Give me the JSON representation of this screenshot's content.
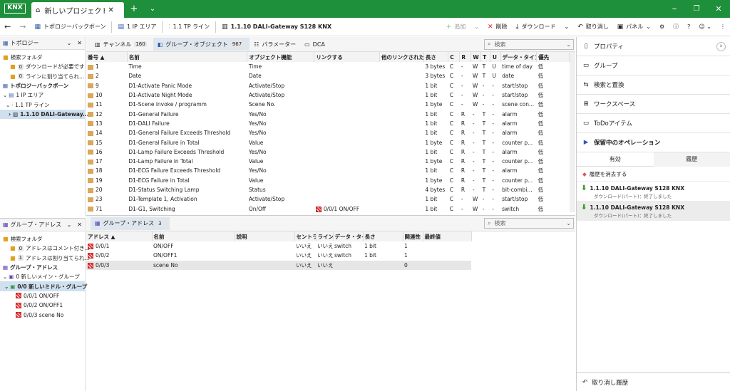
{
  "app": {
    "logo": "KNX",
    "tab_title": "新しいプロジェクト..."
  },
  "toolbar": {
    "breadcrumb": [
      "トポロジーバックボーン",
      "1 IP エリア",
      "1.1 TP ライン",
      "1.1.10 DALI-Gateway S128 KNX"
    ],
    "add": "追加",
    "delete": "削除",
    "download": "ダウンロード",
    "undo": "取り消し",
    "panel": "パネル"
  },
  "topology": {
    "title": "トポロジー",
    "items": [
      {
        "label": "検索フォルダ",
        "badge": ""
      },
      {
        "label": "ダウンロードが必要です",
        "badge": "0"
      },
      {
        "label": "ラインに割り当てられ...",
        "badge": "0"
      },
      {
        "label": "トポロジーバックボーン",
        "badge": ""
      },
      {
        "label": "1 IP エリア",
        "badge": ""
      },
      {
        "label": "1.1 TP ライン",
        "badge": ""
      },
      {
        "label": "1.1.10 DALI-Gateway...",
        "badge": ""
      }
    ]
  },
  "groups_panel": {
    "title": "グループ・アドレス",
    "items": [
      {
        "label": "検索フォルダ",
        "badge": ""
      },
      {
        "label": "アドレスはコメント付き...",
        "badge": "0"
      },
      {
        "label": "アドレスは割り当てられ...",
        "badge": "1"
      },
      {
        "label": "グループ・アドレス",
        "badge": ""
      },
      {
        "label": "0 新しいメイン・グループ",
        "badge": ""
      },
      {
        "label": "0/0 新しいミドル・グループ",
        "badge": ""
      },
      {
        "label": "0/0/1 ON/OFF",
        "badge": ""
      },
      {
        "label": "0/0/2 ON/OFF1",
        "badge": ""
      },
      {
        "label": "0/0/3 scene No",
        "badge": ""
      }
    ]
  },
  "main_tabs": [
    {
      "label": "チャンネル",
      "count": "160"
    },
    {
      "label": "グループ・オブジェクト",
      "count": "967"
    },
    {
      "label": "パラメーター",
      "count": ""
    },
    {
      "label": "DCA",
      "count": ""
    }
  ],
  "search_placeholder": "検索",
  "objects": {
    "headers": [
      "番号 ▲",
      "名前",
      "オブジェクト機能",
      "リンクする",
      "他のリンクされた...",
      "長さ",
      "C",
      "R",
      "W",
      "T",
      "U",
      "データ・タイプ",
      "優先"
    ],
    "rows": [
      [
        "1",
        "Time",
        "Time",
        "",
        "",
        "3 bytes",
        "C",
        "-",
        "W",
        "T",
        "U",
        "time of day",
        "低"
      ],
      [
        "2",
        "Date",
        "Date",
        "",
        "",
        "3 bytes",
        "C",
        "-",
        "W",
        "T",
        "U",
        "date",
        "低"
      ],
      [
        "9",
        "D1-Activate Panic Mode",
        "Activate/Stop",
        "",
        "",
        "1 bit",
        "C",
        "-",
        "W",
        "-",
        "-",
        "start/stop",
        "低"
      ],
      [
        "10",
        "D1-Activate Night Mode",
        "Activate/Stop",
        "",
        "",
        "1 bit",
        "C",
        "-",
        "W",
        "-",
        "-",
        "start/stop",
        "低"
      ],
      [
        "11",
        "D1-Scene invoke / programm",
        "Scene No.",
        "",
        "",
        "1 byte",
        "C",
        "-",
        "W",
        "-",
        "-",
        "scene con...",
        "低"
      ],
      [
        "12",
        "D1-General Failure",
        "Yes/No",
        "",
        "",
        "1 bit",
        "C",
        "R",
        "-",
        "T",
        "-",
        "alarm",
        "低"
      ],
      [
        "13",
        "D1-DALI Failure",
        "Yes/No",
        "",
        "",
        "1 bit",
        "C",
        "R",
        "-",
        "T",
        "-",
        "alarm",
        "低"
      ],
      [
        "14",
        "D1-General Failure Exceeds Threshold",
        "Yes/No",
        "",
        "",
        "1 bit",
        "C",
        "R",
        "-",
        "T",
        "-",
        "alarm",
        "低"
      ],
      [
        "15",
        "D1-General Failure in Total",
        "Value",
        "",
        "",
        "1 byte",
        "C",
        "R",
        "-",
        "T",
        "-",
        "counter p...",
        "低"
      ],
      [
        "16",
        "D1-Lamp Failure Exceeds Threshold",
        "Yes/No",
        "",
        "",
        "1 bit",
        "C",
        "R",
        "-",
        "T",
        "-",
        "alarm",
        "低"
      ],
      [
        "17",
        "D1-Lamp Failure in Total",
        "Value",
        "",
        "",
        "1 byte",
        "C",
        "R",
        "-",
        "T",
        "-",
        "counter p...",
        "低"
      ],
      [
        "18",
        "D1-ECG Failure Exceeds Threshold",
        "Yes/No",
        "",
        "",
        "1 bit",
        "C",
        "R",
        "-",
        "T",
        "-",
        "alarm",
        "低"
      ],
      [
        "19",
        "D1-ECG Failure in Total",
        "Value",
        "",
        "",
        "1 byte",
        "C",
        "R",
        "-",
        "T",
        "-",
        "counter p...",
        "低"
      ],
      [
        "20",
        "D1-Status Switching Lamp",
        "Status",
        "",
        "",
        "4 bytes",
        "C",
        "R",
        "-",
        "T",
        "-",
        "bit-combi...",
        "低"
      ],
      [
        "23",
        "D1-Template 1, Activation",
        "Activate/Stop",
        "",
        "",
        "1 bit",
        "C",
        "-",
        "W",
        "-",
        "-",
        "start/stop",
        "低"
      ],
      [
        "71",
        "D1-G1, Switching",
        "On/Off",
        "0/0/1 ON/OFF",
        "",
        "1 bit",
        "C",
        "-",
        "W",
        "-",
        "-",
        "switch",
        "低"
      ]
    ]
  },
  "ga_tab": {
    "label": "グループ・アドレス",
    "count": "3"
  },
  "addresses": {
    "headers": [
      "アドレス ▲",
      "名前",
      "説明",
      "セントラル",
      "ライン...",
      "データ・タイプ",
      "長さ",
      "関連性",
      "最終値"
    ],
    "rows": [
      [
        "0/0/1",
        "ON/OFF",
        "",
        "いいえ",
        "いいえ",
        "switch",
        "1 bit",
        "1",
        ""
      ],
      [
        "0/0/2",
        "ON/OFF1",
        "",
        "いいえ",
        "いいえ",
        "switch",
        "1 bit",
        "1",
        ""
      ],
      [
        "0/0/3",
        "scene No",
        "",
        "いいえ",
        "いいえ",
        "",
        "",
        "0",
        ""
      ]
    ]
  },
  "right": {
    "items": [
      "プロパティ",
      "グループ",
      "検索と置換",
      "ワークスペース",
      "ToDoアイテム"
    ],
    "pending": "保留中のオペレーション",
    "tabs": [
      "有効",
      "履歴"
    ],
    "clear": "履歴を消去する",
    "history": [
      {
        "title": "1.1.10 DALI-Gateway S128 KNX",
        "sub": "ダウンロード(パート)：終了しました"
      },
      {
        "title": "1.1.10 DALI-Gateway S128 KNX",
        "sub": "ダウンロード(パート)：終了しました"
      }
    ],
    "undo_history": "取り消し履歴"
  }
}
